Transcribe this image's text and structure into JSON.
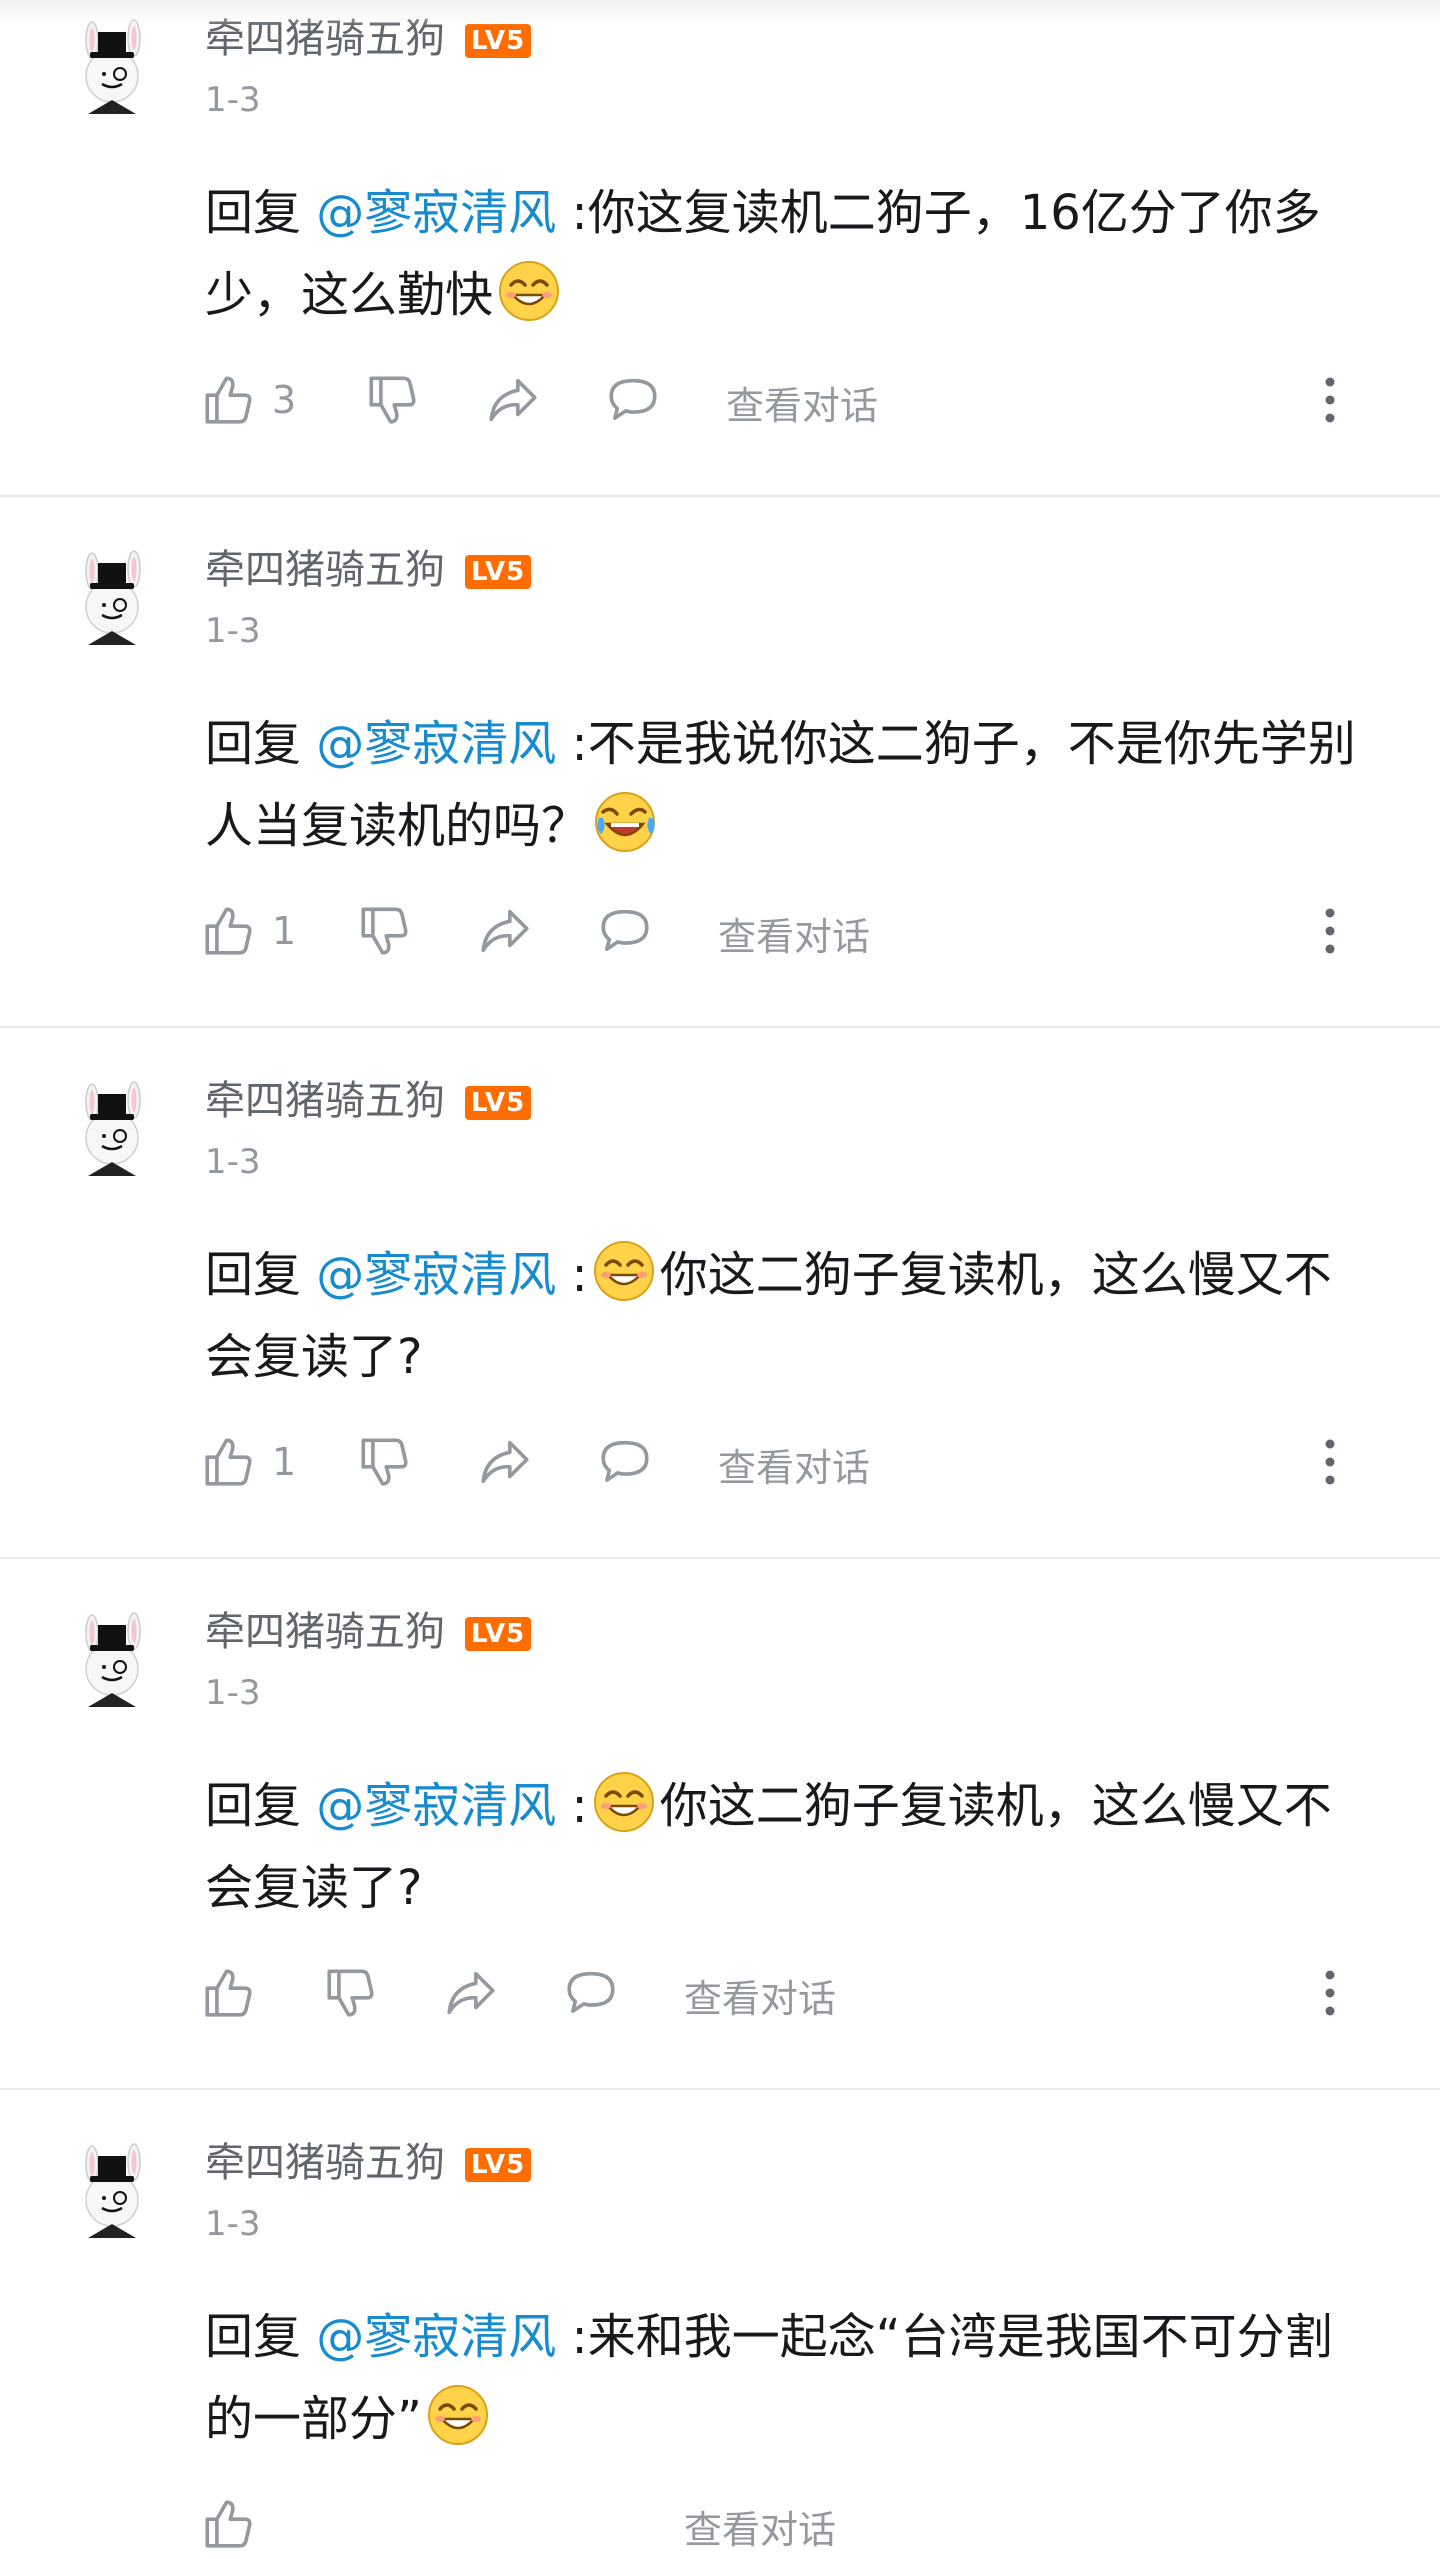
{
  "comments": [
    {
      "username": "牵四猪骑五狗",
      "level": "LV5",
      "time": "1-3",
      "reply_prefix": "回复 ",
      "mention": "@寥寂清风",
      "sep": " :",
      "text_a": "你这复读机二狗子，16亿分了你多少，这么勤快",
      "text_b": "",
      "likes": "3",
      "view_conversation": "查看对话"
    },
    {
      "username": "牵四猪骑五狗",
      "level": "LV5",
      "time": "1-3",
      "reply_prefix": "回复 ",
      "mention": "@寥寂清风",
      "sep": " :",
      "text_a": "不是我说你这二狗子，不是你先学别人当复读机的吗？",
      "text_b": "",
      "likes": "1",
      "view_conversation": "查看对话"
    },
    {
      "username": "牵四猪骑五狗",
      "level": "LV5",
      "time": "1-3",
      "reply_prefix": "回复 ",
      "mention": "@寥寂清风",
      "sep": " :",
      "text_a": "",
      "text_b": "你这二狗子复读机，这么慢又不会复读了?",
      "likes": "1",
      "view_conversation": "查看对话"
    },
    {
      "username": "牵四猪骑五狗",
      "level": "LV5",
      "time": "1-3",
      "reply_prefix": "回复 ",
      "mention": "@寥寂清风",
      "sep": " :",
      "text_a": "",
      "text_b": "你这二狗子复读机，这么慢又不会复读了?",
      "likes": "",
      "view_conversation": "查看对话"
    },
    {
      "username": "牵四猪骑五狗",
      "level": "LV5",
      "time": "1-3",
      "reply_prefix": "回复 ",
      "mention": "@寥寂清风",
      "sep": " :",
      "text_a": "来和我一起念“台湾是我国不可分割的一部分”",
      "text_b": "",
      "likes": "",
      "view_conversation": "查看对话"
    }
  ],
  "icons": {
    "like": "thumbs-up-icon",
    "dislike": "thumbs-down-icon",
    "share": "share-icon",
    "reply": "comment-icon",
    "more": "more-vertical-icon",
    "emoji_grin": "grin-emoji",
    "emoji_laugh": "laugh-cry-emoji"
  },
  "colors": {
    "mention": "#178bcf",
    "level_badge": "#ff6c00",
    "secondary_text": "#9499a0"
  }
}
